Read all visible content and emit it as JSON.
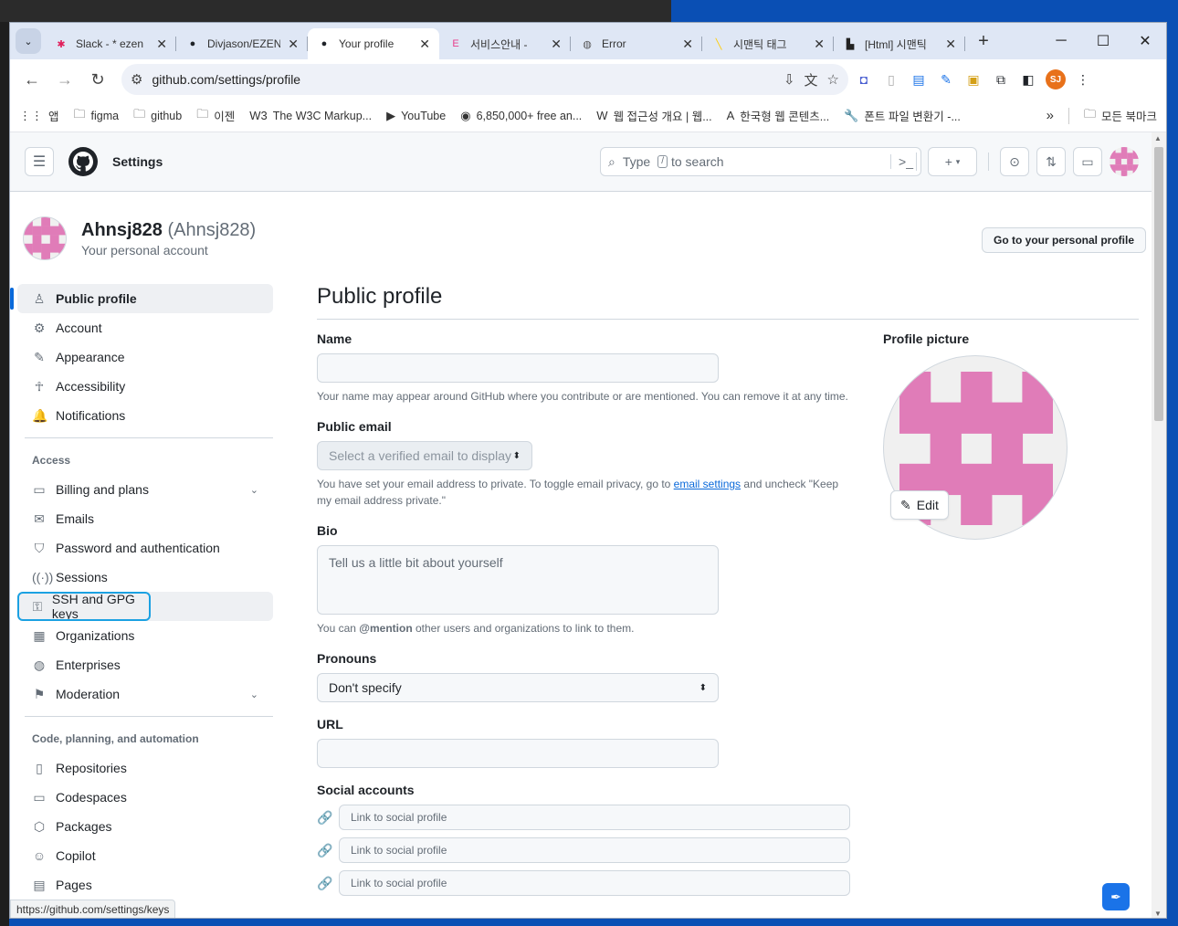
{
  "browser": {
    "tabs": [
      {
        "title": "Slack - * ezen",
        "icon": "slack-icon",
        "color": "#e01e5a"
      },
      {
        "title": "Divjason/EZEN",
        "icon": "github-icon",
        "color": "#1f2328"
      },
      {
        "title": "Your profile",
        "icon": "github-icon",
        "color": "#1f2328",
        "active": true
      },
      {
        "title": "서비스안내 -",
        "icon": "e-icon",
        "color": "#e83e8c"
      },
      {
        "title": "Error",
        "icon": "globe-icon",
        "color": "#555555"
      },
      {
        "title": "시맨틱 태그",
        "icon": "yellow-slash-icon",
        "color": "#ffcc00"
      },
      {
        "title": "[Html] 시맨틱",
        "icon": "factory-icon",
        "color": "#222222"
      }
    ],
    "url": "github.com/settings/profile",
    "profile_initials": "SJ",
    "bookmarks": [
      {
        "label": "앱",
        "icon": "apps-grid-icon"
      },
      {
        "label": "figma",
        "icon": "folder-icon"
      },
      {
        "label": "github",
        "icon": "folder-icon"
      },
      {
        "label": "이젠",
        "icon": "folder-icon"
      },
      {
        "label": "The W3C Markup...",
        "icon": "w3c-icon"
      },
      {
        "label": "YouTube",
        "icon": "youtube-icon"
      },
      {
        "label": "6,850,000+ free an...",
        "icon": "eye-icon"
      },
      {
        "label": "웹 접근성 개요 | 웹...",
        "icon": "w-icon"
      },
      {
        "label": "한국형 웹 콘텐츠...",
        "icon": "pdf-icon"
      },
      {
        "label": "폰트 파일 변환기 -...",
        "icon": "wrench-icon"
      }
    ],
    "bookmarks_more": "»",
    "all_bookmarks": "모든 북마크",
    "status_url": "https://github.com/settings/keys"
  },
  "header": {
    "context": "Settings",
    "search_prefix": "Type",
    "search_slash": "/",
    "search_suffix": "to search"
  },
  "user": {
    "name": "Ahnsj828",
    "handle": "(Ahnsj828)",
    "subtitle": "Your personal account",
    "go_profile": "Go to your personal profile"
  },
  "sidebar": {
    "top": [
      {
        "label": "Public profile",
        "icon": "person-icon",
        "current": true
      },
      {
        "label": "Account",
        "icon": "gear-icon"
      },
      {
        "label": "Appearance",
        "icon": "paintbrush-icon"
      },
      {
        "label": "Accessibility",
        "icon": "accessibility-icon"
      },
      {
        "label": "Notifications",
        "icon": "bell-icon"
      }
    ],
    "access_title": "Access",
    "access": [
      {
        "label": "Billing and plans",
        "icon": "credit-card-icon",
        "chevron": true
      },
      {
        "label": "Emails",
        "icon": "mail-icon"
      },
      {
        "label": "Password and authentication",
        "icon": "shield-icon"
      },
      {
        "label": "Sessions",
        "icon": "broadcast-icon"
      },
      {
        "label": "SSH and GPG keys",
        "icon": "key-icon",
        "focused": true
      },
      {
        "label": "Organizations",
        "icon": "organization-icon"
      },
      {
        "label": "Enterprises",
        "icon": "globe-icon"
      },
      {
        "label": "Moderation",
        "icon": "report-icon",
        "chevron": true
      }
    ],
    "code_title": "Code, planning, and automation",
    "code": [
      {
        "label": "Repositories",
        "icon": "repo-icon"
      },
      {
        "label": "Codespaces",
        "icon": "codespaces-icon"
      },
      {
        "label": "Packages",
        "icon": "package-icon"
      },
      {
        "label": "Copilot",
        "icon": "copilot-icon"
      },
      {
        "label": "Pages",
        "icon": "browser-icon"
      }
    ]
  },
  "main": {
    "title": "Public profile",
    "name_label": "Name",
    "name_value": "",
    "name_note": "Your name may appear around GitHub where you contribute or are mentioned. You can remove it at any time.",
    "email_label": "Public email",
    "email_select": "Select a verified email to display",
    "email_note_1": "You have set your email address to private. To toggle email privacy, go to",
    "email_note_link": "email settings",
    "email_note_2": "and uncheck \"Keep my email address private.\"",
    "bio_label": "Bio",
    "bio_placeholder": "Tell us a little bit about yourself",
    "bio_note_1": "You can",
    "bio_note_mention": "@mention",
    "bio_note_2": "other users and organizations to link to them.",
    "pronouns_label": "Pronouns",
    "pronouns_value": "Don't specify",
    "url_label": "URL",
    "url_value": "",
    "social_label": "Social accounts",
    "social_placeholder": "Link to social profile",
    "picture_label": "Profile picture",
    "edit_label": "Edit"
  },
  "colors": {
    "identicon": "#e07cb8",
    "accent": "#0969da",
    "focus_ring": "#1ba1e2"
  }
}
